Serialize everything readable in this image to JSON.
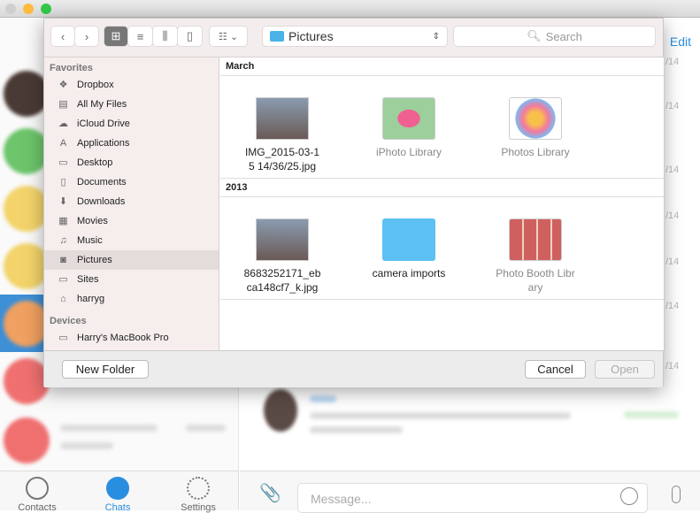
{
  "window": {
    "lights": [
      "#cfcfcf",
      "#fdbc40",
      "#34c84a"
    ]
  },
  "app": {
    "edit_label": "Edit",
    "date_suffix": "/14",
    "tabs": [
      {
        "label": "Contacts",
        "icon": "contacts-icon"
      },
      {
        "label": "Chats",
        "icon": "chats-icon"
      },
      {
        "label": "Settings",
        "icon": "settings-icon"
      }
    ],
    "message_placeholder": "Message..."
  },
  "dialog": {
    "location": "Pictures",
    "search_placeholder": "Search",
    "sidebar": {
      "favorites_label": "Favorites",
      "favorites": [
        {
          "label": "Dropbox",
          "icon": "dropbox-icon"
        },
        {
          "label": "All My Files",
          "icon": "all-files-icon"
        },
        {
          "label": "iCloud Drive",
          "icon": "cloud-icon"
        },
        {
          "label": "Applications",
          "icon": "applications-icon"
        },
        {
          "label": "Desktop",
          "icon": "desktop-icon"
        },
        {
          "label": "Documents",
          "icon": "documents-icon"
        },
        {
          "label": "Downloads",
          "icon": "downloads-icon"
        },
        {
          "label": "Movies",
          "icon": "movies-icon"
        },
        {
          "label": "Music",
          "icon": "music-icon"
        },
        {
          "label": "Pictures",
          "icon": "camera-icon",
          "selected": true
        },
        {
          "label": "Sites",
          "icon": "sites-icon"
        },
        {
          "label": "harryg",
          "icon": "home-icon"
        }
      ],
      "devices_label": "Devices",
      "devices": [
        {
          "label": "Harry's MacBook Pro",
          "icon": "laptop-icon"
        }
      ]
    },
    "groups": [
      {
        "title": "March",
        "items": [
          {
            "name": "IMG_2015-03-15 14/36/25.jpg",
            "type": "image"
          },
          {
            "name": "iPhoto Library",
            "type": "iphoto",
            "dim": true
          },
          {
            "name": "Photos Library",
            "type": "photos",
            "dim": true
          }
        ]
      },
      {
        "title": "2013",
        "items": [
          {
            "name": "8683252171_ebca148cf7_k.jpg",
            "type": "image"
          },
          {
            "name": "camera imports",
            "type": "folder"
          },
          {
            "name": "Photo Booth Library",
            "type": "photobooth",
            "dim": true
          }
        ]
      }
    ],
    "new_folder_label": "New Folder",
    "cancel_label": "Cancel",
    "open_label": "Open"
  }
}
